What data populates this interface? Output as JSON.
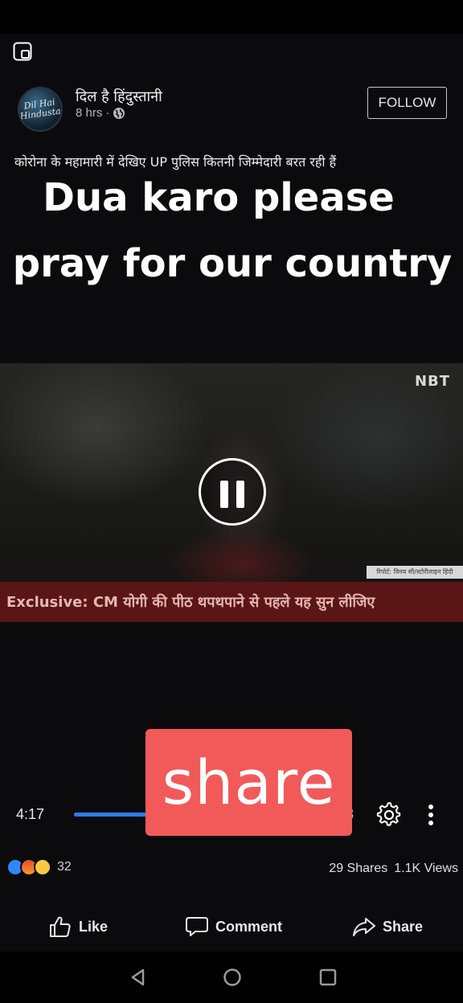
{
  "post": {
    "page_name": "दिल है हिंदुस्तानी",
    "avatar_text": "Dil Hai Hindustani",
    "time": "8 hrs",
    "separator": "·",
    "follow_label": "FOLLOW",
    "caption": "कोरोना के महामारी में देखिए UP पुलिस कितनी जिम्मेदारी बरत रही हैं"
  },
  "overlay": {
    "line1": "Dua karo please",
    "line2": "pray for our country",
    "sticker": "share"
  },
  "video": {
    "channel_logo": "NBT",
    "credit": "रिपोर्ट: विनय सी/स्टोरीलाइन हिंदी",
    "ticker": "Exclusive: CM योगी की पीठ थपथपाने से पहले यह सुन लीजिए",
    "elapsed": "4:17",
    "total_visible": "8",
    "progress": 0.27,
    "accent_color": "#2f7bf0"
  },
  "engagement": {
    "reaction_count": "32",
    "reactions": [
      "like-icon",
      "angry-icon",
      "sad-icon"
    ],
    "shares": "29 Shares",
    "views": "1.1K Views"
  },
  "actions": {
    "like": "Like",
    "comment": "Comment",
    "share": "Share"
  },
  "colors": {
    "sticker_bg": "#f25a5a",
    "ticker_bg": "#5a1616"
  }
}
